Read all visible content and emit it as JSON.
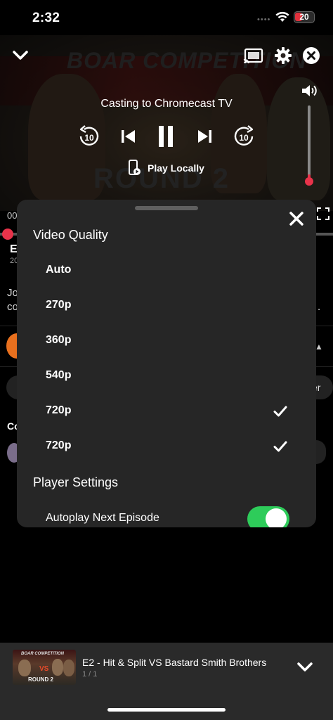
{
  "status_bar": {
    "time": "2:32",
    "battery": "20"
  },
  "player": {
    "casting_text": "Casting to Chromecast TV",
    "play_locally_label": "Play Locally",
    "skip_back_seconds": "10",
    "skip_forward_seconds": "10",
    "thumbnail_title": "BOAR COMPETITION",
    "thumbnail_round": "ROUND 2",
    "volume_level": 0.05
  },
  "background_page": {
    "time_fragment": "00",
    "episode_fragment": "E",
    "year_fragment": "20",
    "desc_fragment_1": "Jo",
    "desc_fragment_2": "co",
    "desc_fragment_end": ".",
    "pill_fragment": "er",
    "comments_fragment": "Co"
  },
  "quality_sheet": {
    "video_quality_title": "Video Quality",
    "options": [
      {
        "label": "Auto",
        "selected": false
      },
      {
        "label": "270p",
        "selected": false
      },
      {
        "label": "360p",
        "selected": false
      },
      {
        "label": "540p",
        "selected": false
      },
      {
        "label": "720p",
        "selected": true
      },
      {
        "label": "720p",
        "selected": true
      }
    ],
    "player_settings_title": "Player Settings",
    "autoplay_label": "Autoplay Next Episode",
    "autoplay_enabled": true
  },
  "mini_player": {
    "title": "E2 - Hit & Split VS Bastard Smith Brothers",
    "count": "1 / 1",
    "thumb_title": "BOAR COMPETITION",
    "thumb_round": "ROUND 2",
    "thumb_vs": "VS"
  },
  "colors": {
    "accent_red": "#e8334a",
    "toggle_green": "#2ecc5a",
    "sheet_bg": "#262626"
  }
}
